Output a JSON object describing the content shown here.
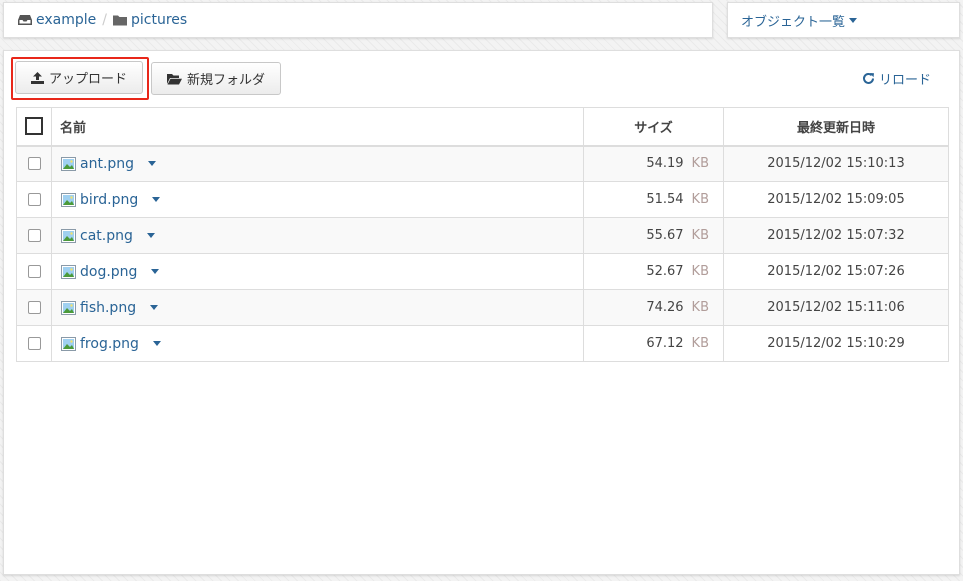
{
  "breadcrumb": {
    "root": "example",
    "separator": "/",
    "folder": "pictures"
  },
  "objects_menu": {
    "label": "オブジェクト一覧"
  },
  "toolbar": {
    "upload_label": "アップロード",
    "new_folder_label": "新規フォルダ",
    "reload_label": "リロード"
  },
  "table": {
    "columns": {
      "name": "名前",
      "size": "サイズ",
      "modified": "最終更新日時"
    },
    "rows": [
      {
        "name": "ant.png",
        "size": "54.19",
        "unit": "KB",
        "modified": "2015/12/02 15:10:13"
      },
      {
        "name": "bird.png",
        "size": "51.54",
        "unit": "KB",
        "modified": "2015/12/02 15:09:05"
      },
      {
        "name": "cat.png",
        "size": "55.67",
        "unit": "KB",
        "modified": "2015/12/02 15:07:32"
      },
      {
        "name": "dog.png",
        "size": "52.67",
        "unit": "KB",
        "modified": "2015/12/02 15:07:26"
      },
      {
        "name": "fish.png",
        "size": "74.26",
        "unit": "KB",
        "modified": "2015/12/02 15:11:06"
      },
      {
        "name": "frog.png",
        "size": "67.12",
        "unit": "KB",
        "modified": "2015/12/02 15:10:29"
      }
    ]
  },
  "icons": {
    "root": "inbox-icon",
    "folder": "folder-icon",
    "upload": "upload-icon",
    "new_folder": "folder-open-icon",
    "reload": "refresh-icon",
    "file": "image-file-icon"
  },
  "colors": {
    "link": "#2a6496",
    "highlight": "#e8271a",
    "unit": "#b19d9a"
  }
}
